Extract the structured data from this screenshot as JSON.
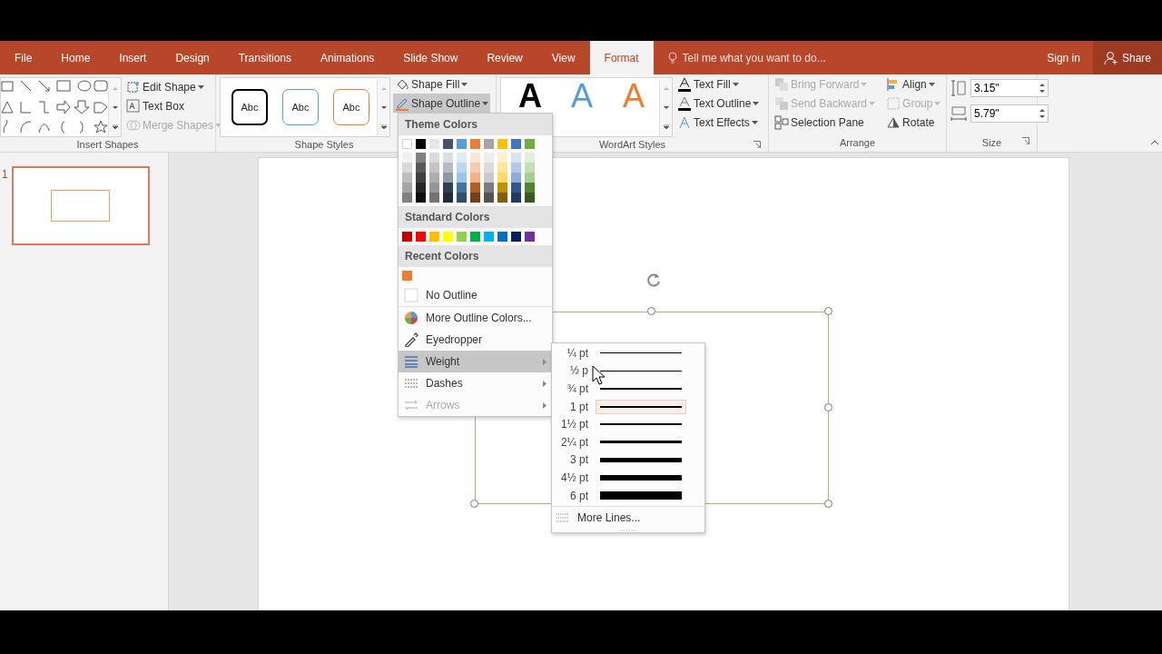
{
  "ribbon_tabs": [
    {
      "label": "File",
      "selected": false
    },
    {
      "label": "Home",
      "selected": false
    },
    {
      "label": "Insert",
      "selected": false
    },
    {
      "label": "Design",
      "selected": false
    },
    {
      "label": "Transitions",
      "selected": false
    },
    {
      "label": "Animations",
      "selected": false
    },
    {
      "label": "Slide Show",
      "selected": false
    },
    {
      "label": "Review",
      "selected": false
    },
    {
      "label": "View",
      "selected": false
    },
    {
      "label": "Format",
      "selected": true
    }
  ],
  "tell_me": {
    "placeholder": "Tell me what you want to do..."
  },
  "sign_in": "Sign in",
  "share": "Share",
  "insert_shapes": {
    "label": "Insert Shapes",
    "commands": [
      {
        "label": "Edit Shape",
        "disabled": false,
        "dropdown": true
      },
      {
        "label": "Text Box",
        "disabled": false,
        "dropdown": false
      },
      {
        "label": "Merge Shapes",
        "disabled": true,
        "dropdown": true
      }
    ]
  },
  "shape_styles": {
    "label": "Shape Styles",
    "presets": [
      {
        "label": "Abc",
        "color": "#000000"
      },
      {
        "label": "Abc",
        "color": "#5b9bd5"
      },
      {
        "label": "Abc",
        "color": "#ed7d31"
      }
    ],
    "commands": [
      {
        "label": "Shape Fill",
        "selected": false
      },
      {
        "label": "Shape Outline",
        "selected": true
      }
    ]
  },
  "wordart_styles": {
    "label": "WordArt Styles",
    "presets": [
      {
        "label": "A",
        "color": "#000000"
      },
      {
        "label": "A",
        "color": "#5b9bd5"
      },
      {
        "label": "A",
        "color": "#ed7d31"
      }
    ],
    "commands": [
      {
        "label": "Text Fill"
      },
      {
        "label": "Text Outline"
      },
      {
        "label": "Text Effects"
      }
    ]
  },
  "arrange": {
    "label": "Arrange",
    "commands": [
      {
        "label": "Bring Forward",
        "disabled": true
      },
      {
        "label": "Send Backward",
        "disabled": true
      },
      {
        "label": "Selection Pane",
        "disabled": false
      },
      {
        "label": "Align",
        "disabled": false
      },
      {
        "label": "Group",
        "disabled": true
      },
      {
        "label": "Rotate",
        "disabled": false
      }
    ]
  },
  "size": {
    "label": "Size",
    "height": "3.15\"",
    "width": "5.79\""
  },
  "slides": [
    {
      "number": "1",
      "selected": true
    }
  ],
  "outline_menu": {
    "theme_heading": "Theme Colors",
    "theme_colors": [
      {
        "color": "#ffffff"
      },
      {
        "color": "#000000"
      },
      {
        "color": "#e7e6e6"
      },
      {
        "color": "#44546a"
      },
      {
        "color": "#5b9bd5"
      },
      {
        "color": "#ed7d31"
      },
      {
        "color": "#a5a5a5"
      },
      {
        "color": "#ffc000"
      },
      {
        "color": "#4472c4"
      },
      {
        "color": "#70ad47"
      }
    ],
    "standard_heading": "Standard Colors",
    "standard_colors": [
      {
        "color": "#c00000"
      },
      {
        "color": "#ff0000"
      },
      {
        "color": "#ffc000"
      },
      {
        "color": "#ffff00"
      },
      {
        "color": "#92d050"
      },
      {
        "color": "#00b050"
      },
      {
        "color": "#00b0f0"
      },
      {
        "color": "#0070c0"
      },
      {
        "color": "#002060"
      },
      {
        "color": "#7030a0"
      }
    ],
    "recent_heading": "Recent Colors",
    "recent_colors": [
      {
        "color": "#ed7d31"
      }
    ],
    "items": [
      {
        "label": "No Outline",
        "kind": "none",
        "selected": false,
        "disabled": false,
        "submenu": false
      },
      {
        "label": "More Outline Colors...",
        "kind": "palette",
        "selected": false,
        "disabled": false,
        "submenu": false
      },
      {
        "label": "Eyedropper",
        "kind": "eyedropper",
        "selected": false,
        "disabled": false,
        "submenu": false
      },
      {
        "label": "Weight",
        "kind": "weight",
        "selected": true,
        "disabled": false,
        "submenu": true
      },
      {
        "label": "Dashes",
        "kind": "dashes",
        "selected": false,
        "disabled": false,
        "submenu": true
      },
      {
        "label": "Arrows",
        "kind": "arrows",
        "selected": false,
        "disabled": true,
        "submenu": true
      }
    ]
  },
  "weight_menu": {
    "items": [
      {
        "label": "¼ pt",
        "selected": false
      },
      {
        "label": "½ p",
        "selected": false
      },
      {
        "label": "¾ pt",
        "selected": false
      },
      {
        "label": "1 pt",
        "selected": true
      },
      {
        "label": "1½ pt",
        "selected": false
      },
      {
        "label": "2¼ pt",
        "selected": false
      },
      {
        "label": "3 pt",
        "selected": false
      },
      {
        "label": "4½ pt",
        "selected": false
      },
      {
        "label": "6 pt",
        "selected": false
      }
    ],
    "more": "More Lines..."
  }
}
